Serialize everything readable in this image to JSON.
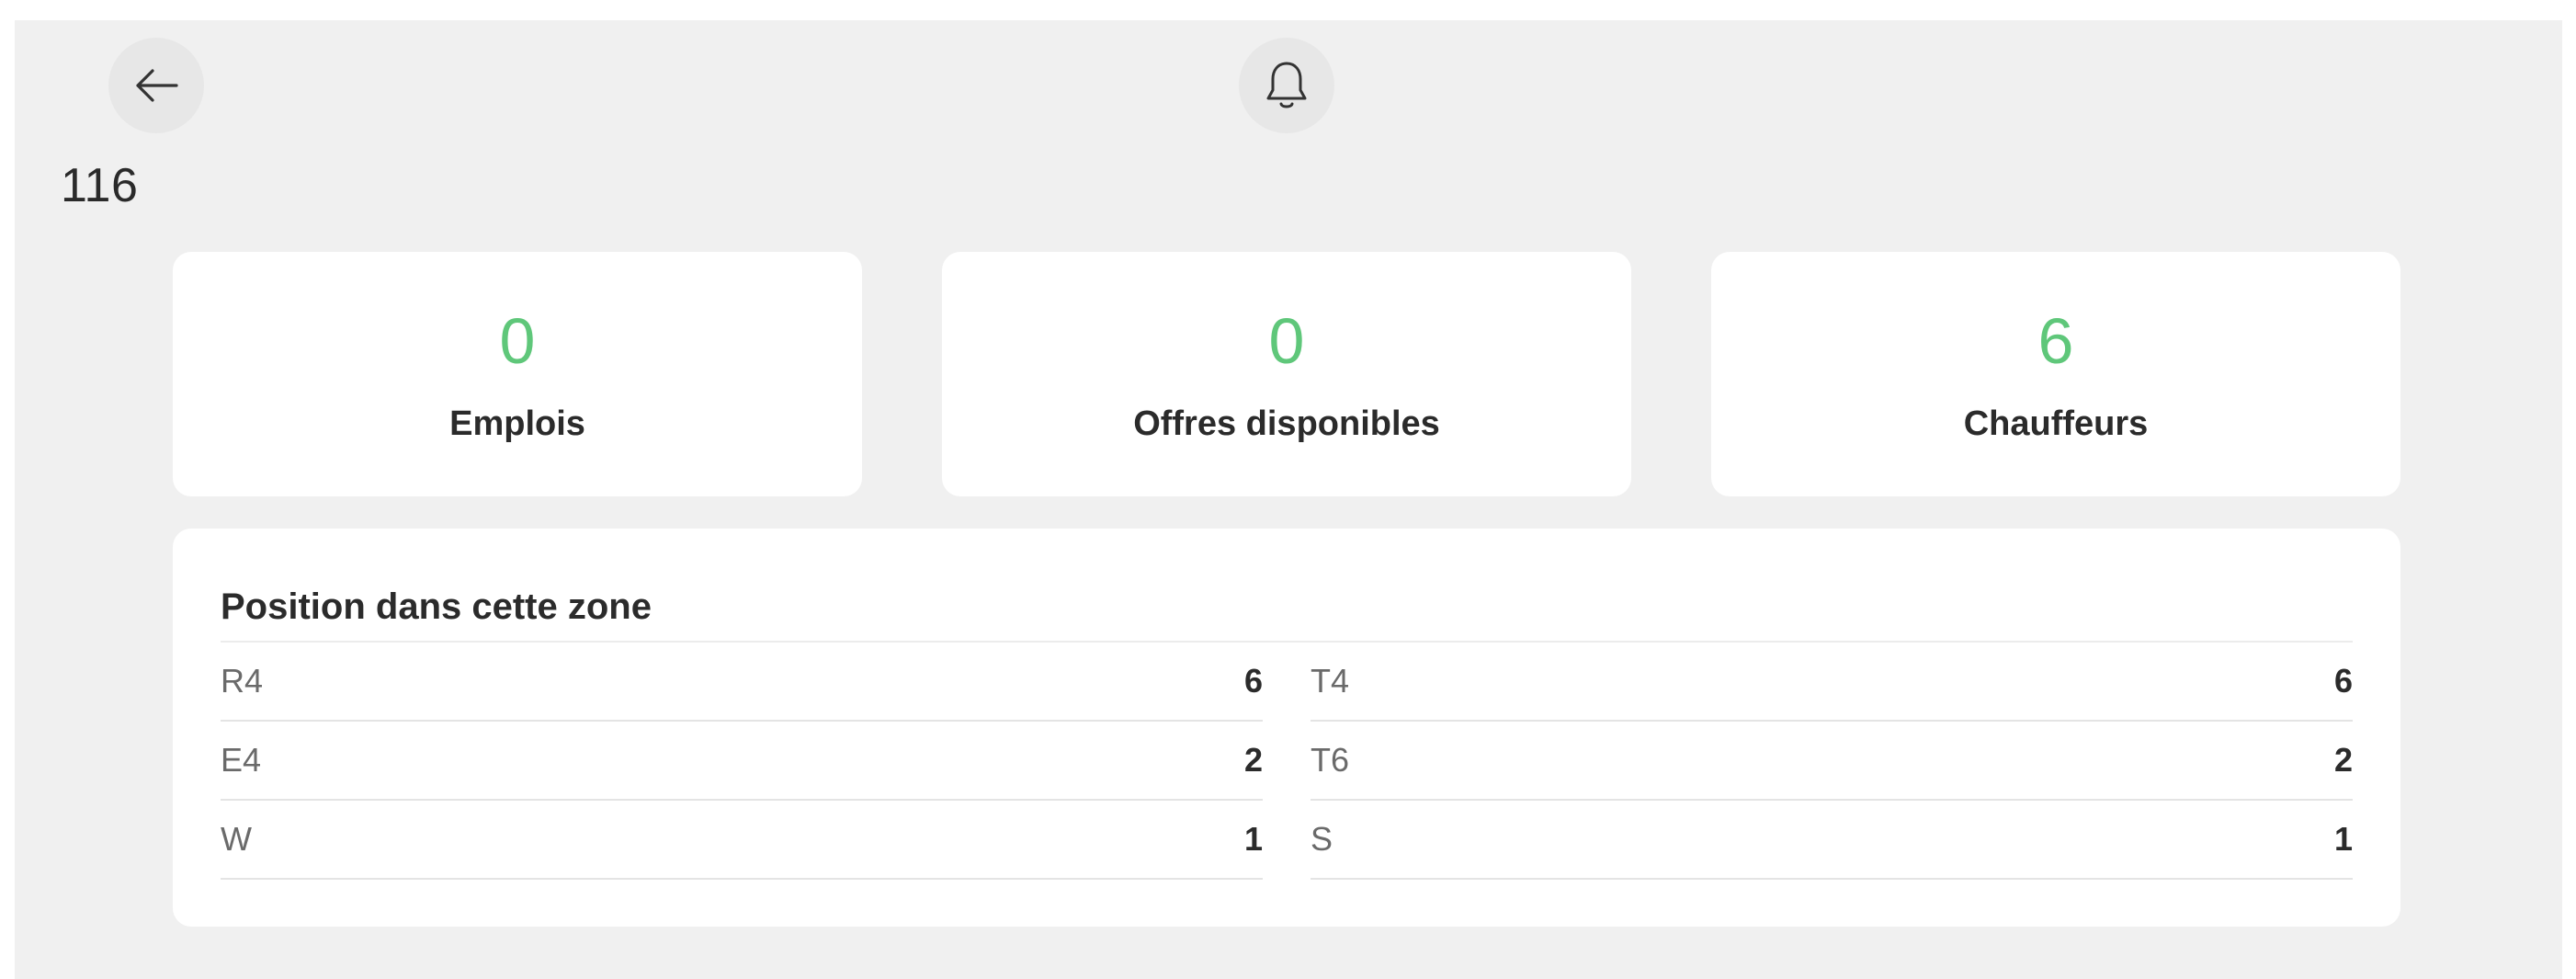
{
  "header": {
    "back_icon": "arrow-left-icon",
    "notification_icon": "bell-icon",
    "zone_id": "116"
  },
  "stats": [
    {
      "value": "0",
      "label": "Emplois"
    },
    {
      "value": "0",
      "label": "Offres disponibles"
    },
    {
      "value": "6",
      "label": "Chauffeurs"
    }
  ],
  "positions": {
    "title": "Position dans cette zone",
    "left": [
      {
        "code": "R4",
        "count": "6"
      },
      {
        "code": "E4",
        "count": "2"
      },
      {
        "code": "W",
        "count": "1"
      }
    ],
    "right": [
      {
        "code": "T4",
        "count": "6"
      },
      {
        "code": "T6",
        "count": "2"
      },
      {
        "code": "S",
        "count": "1"
      }
    ]
  },
  "colors": {
    "accent_green": "#5fc77a",
    "background": "#f0f0f0",
    "card": "#ffffff"
  }
}
